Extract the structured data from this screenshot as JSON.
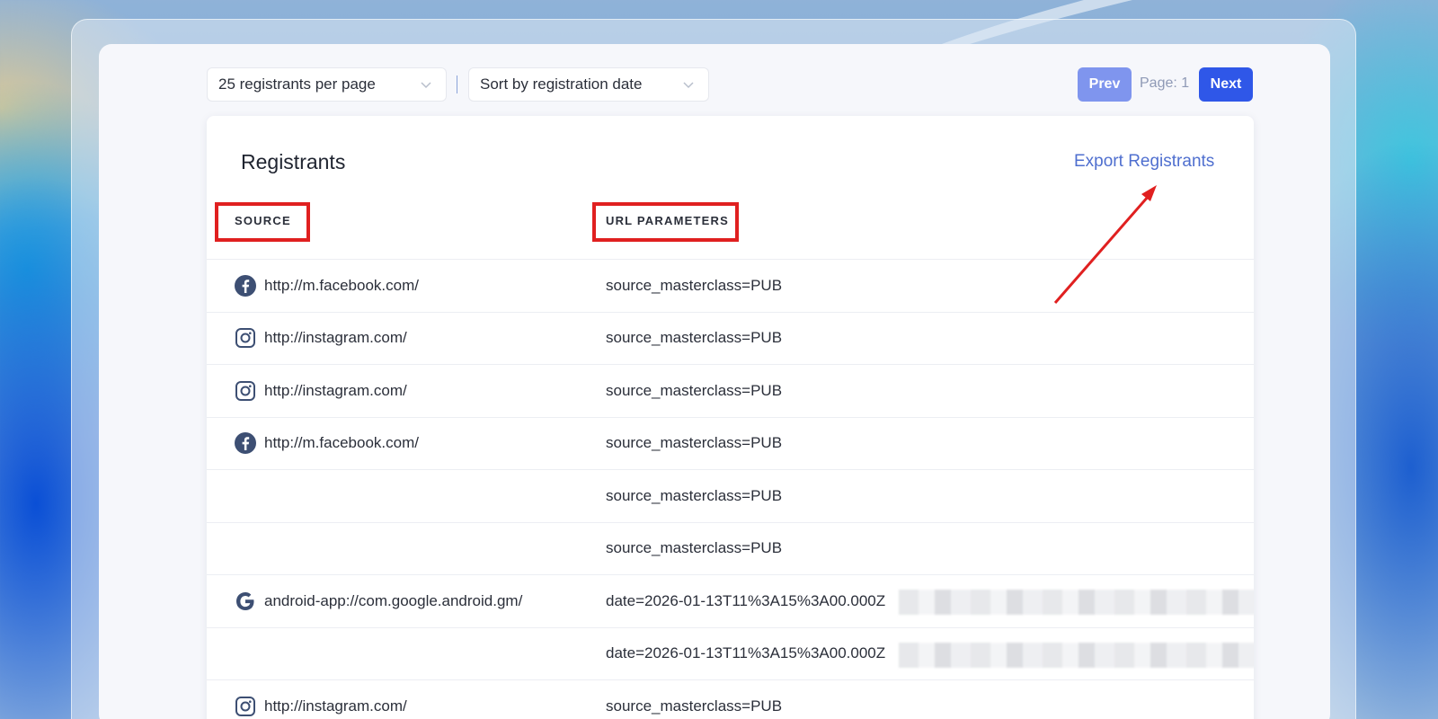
{
  "toolbar": {
    "per_page": "25 registrants per page",
    "sort": "Sort by registration date",
    "prev_label": "Prev",
    "page_label": "Page: 1",
    "next_label": "Next"
  },
  "card": {
    "title": "Registrants",
    "export_label": "Export Registrants"
  },
  "table": {
    "columns": [
      "SOURCE",
      "URL PARAMETERS"
    ],
    "rows": [
      {
        "icon": "facebook-icon",
        "source": "http://m.facebook.com/",
        "params": "source_masterclass=PUB"
      },
      {
        "icon": "instagram-icon",
        "source": "http://instagram.com/",
        "params": "source_masterclass=PUB"
      },
      {
        "icon": "instagram-icon",
        "source": "http://instagram.com/",
        "params": "source_masterclass=PUB"
      },
      {
        "icon": "facebook-icon",
        "source": "http://m.facebook.com/",
        "params": "source_masterclass=PUB"
      },
      {
        "icon": "",
        "source": "",
        "params": "source_masterclass=PUB"
      },
      {
        "icon": "",
        "source": "",
        "params": "source_masterclass=PUB"
      },
      {
        "icon": "google-icon",
        "source": "android-app://com.google.android.gm/",
        "params": "date=2026-01-13T11%3A15%3A00.000Z"
      },
      {
        "icon": "",
        "source": "",
        "params": "date=2026-01-13T11%3A15%3A00.000Z"
      },
      {
        "icon": "instagram-icon",
        "source": "http://instagram.com/",
        "params": "source_masterclass=PUB"
      }
    ]
  },
  "colors": {
    "highlight": "#e02020",
    "primary": "#2f57e8",
    "link": "#4f6fcf"
  }
}
